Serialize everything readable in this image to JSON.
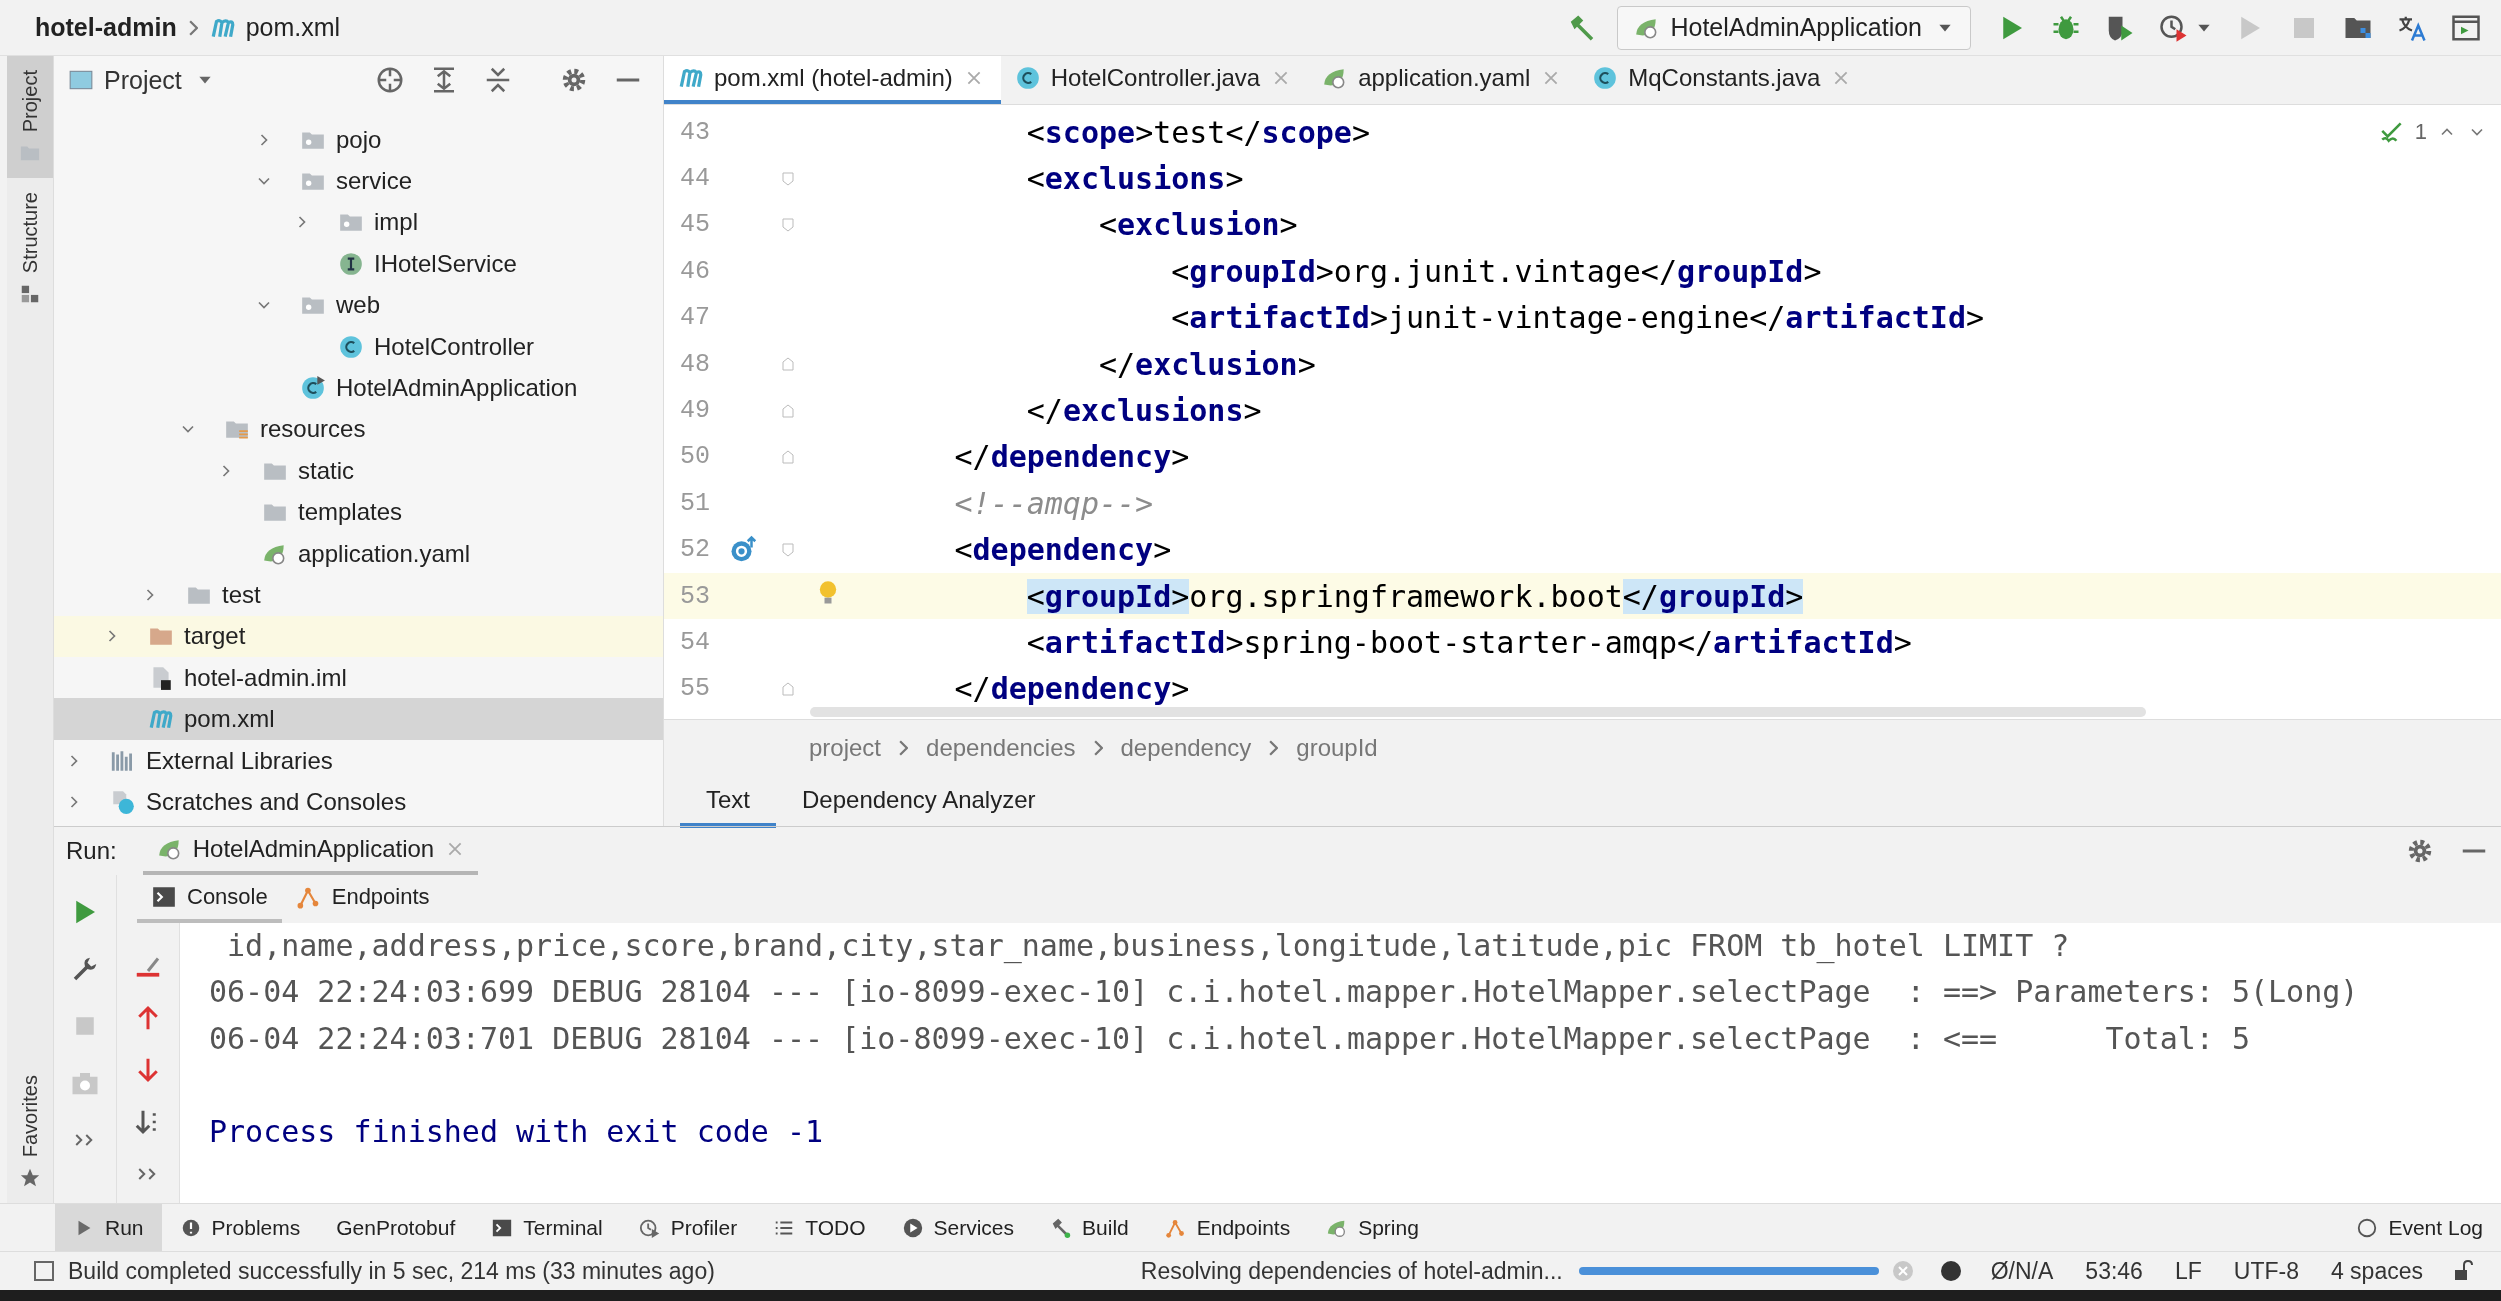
{
  "nav_bar": {
    "breadcrumbs": [
      {
        "label": "hotel-admin"
      },
      {
        "label": "pom.xml",
        "kind": "maven"
      }
    ],
    "run_config": "HotelAdminApplication"
  },
  "side_stripe": {
    "top": [
      {
        "label": "Project",
        "kind": "folder",
        "selected": true
      },
      {
        "label": "Structure",
        "kind": "structure",
        "selected": false
      }
    ],
    "bottom": [
      {
        "label": "Favorites",
        "kind": "star",
        "selected": false
      }
    ]
  },
  "project_panel": {
    "title": "Project",
    "tree": [
      {
        "children": [
          {
            "children": [
              {
                "children": [
                  {
                    "children": [
                      {
                        "children": [
                          {
                            "label": "pojo",
                            "kind": "package",
                            "expanded": false,
                            "selected": false
                          },
                          {
                            "label": "service",
                            "kind": "package",
                            "expanded": true,
                            "selected": false,
                            "children": [
                              {
                                "label": "impl",
                                "kind": "package",
                                "expanded": false,
                                "selected": false
                              },
                              {
                                "label": "IHotelService",
                                "kind": "interface",
                                "selected": false
                              }
                            ]
                          },
                          {
                            "label": "web",
                            "kind": "package",
                            "expanded": true,
                            "selected": false,
                            "children": [
                              {
                                "label": "HotelController",
                                "kind": "class",
                                "selected": false
                              }
                            ]
                          },
                          {
                            "label": "HotelAdminApplication",
                            "kind": "spring-class",
                            "selected": false
                          }
                        ]
                      }
                    ]
                  },
                  {
                    "label": "resources",
                    "kind": "resources",
                    "expanded": true,
                    "selected": false,
                    "children": [
                      {
                        "label": "static",
                        "kind": "folder",
                        "expanded": false,
                        "selected": false
                      },
                      {
                        "label": "templates",
                        "kind": "folder",
                        "selected": false
                      },
                      {
                        "label": "application.yaml",
                        "kind": "spring",
                        "selected": false
                      }
                    ]
                  }
                ]
              },
              {
                "label": "test",
                "kind": "folder",
                "expanded": false,
                "selected": false
              }
            ]
          },
          {
            "label": "target",
            "kind": "excluded",
            "expanded": false,
            "selected": false
          },
          {
            "label": "hotel-admin.iml",
            "kind": "iml",
            "selected": false
          },
          {
            "label": "pom.xml",
            "kind": "maven",
            "selected": true
          }
        ]
      },
      {
        "label": "External Libraries",
        "kind": "libraries",
        "expanded": false,
        "selected": false
      },
      {
        "label": "Scratches and Consoles",
        "kind": "scratches",
        "expanded": false,
        "selected": false
      }
    ]
  },
  "editor": {
    "tabs": [
      {
        "label": "pom.xml (hotel-admin)",
        "kind": "maven",
        "selected": true
      },
      {
        "label": "HotelController.java",
        "kind": "class",
        "selected": false
      },
      {
        "label": "application.yaml",
        "kind": "spring",
        "selected": false
      },
      {
        "label": "MqConstants.java",
        "kind": "class",
        "selected": false
      }
    ],
    "inspection": {
      "count": "1"
    },
    "lines": [
      {
        "number": "43",
        "code": "            <scope>test</scope>",
        "current": false
      },
      {
        "number": "44",
        "code": "            <exclusions>",
        "gutter_marks": [
          {
            "kind": "fold-start"
          }
        ],
        "current": false
      },
      {
        "number": "45",
        "code": "                <exclusion>",
        "gutter_marks": [
          {
            "kind": "fold-start"
          }
        ],
        "current": false
      },
      {
        "number": "46",
        "code": "                    <groupId>org.junit.vintage</groupId>",
        "current": false
      },
      {
        "number": "47",
        "code": "                    <artifactId>junit-vintage-engine</artifactId>",
        "current": false
      },
      {
        "number": "48",
        "code": "                </exclusion>",
        "gutter_marks": [
          {
            "kind": "fold-end"
          }
        ],
        "current": false
      },
      {
        "number": "49",
        "code": "            </exclusions>",
        "gutter_marks": [
          {
            "kind": "fold-end"
          }
        ],
        "current": false
      },
      {
        "number": "50",
        "code": "        </dependency>",
        "gutter_marks": [
          {
            "kind": "fold-end"
          }
        ],
        "current": false
      },
      {
        "number": "51",
        "code": "        <!--amqp-->",
        "current": false
      },
      {
        "number": "52",
        "code": "        <dependency>",
        "gutter_marks": [
          {
            "kind": "overrides"
          },
          {
            "kind": "fold-start"
          }
        ],
        "current": false
      },
      {
        "number": "53",
        "code": "            <groupId>org.springframework.boot</groupId>",
        "gutter_marks": [
          {
            "kind": "bulb"
          }
        ],
        "current": true,
        "matched_tags": true
      },
      {
        "number": "54",
        "code": "            <artifactId>spring-boot-starter-amqp</artifactId>",
        "current": false
      },
      {
        "number": "55",
        "code": "        </dependency>",
        "gutter_marks": [
          {
            "kind": "fold-end"
          }
        ],
        "current": false
      }
    ],
    "breadcrumbs": [
      "project",
      "dependencies",
      "dependency",
      "groupId"
    ],
    "view_tabs": [
      {
        "label": "Text",
        "selected": true
      },
      {
        "label": "Dependency Analyzer",
        "selected": false
      }
    ]
  },
  "run_panel": {
    "label": "Run:",
    "tabs": [
      {
        "label": "HotelAdminApplication",
        "selected": true
      }
    ],
    "subtabs": [
      {
        "label": "Console",
        "kind": "console",
        "selected": true
      },
      {
        "label": "Endpoints",
        "kind": "endpoints",
        "selected": false
      }
    ],
    "console": [
      {
        "text": " id,name,address,price,score,brand,city,star_name,business,longitude,latitude,pic FROM tb_hotel LIMIT ?",
        "kind": "log"
      },
      {
        "text": "06-04 22:24:03:699 DEBUG 28104 --- [io-8099-exec-10] c.i.hotel.mapper.HotelMapper.selectPage  : ==> Parameters: 5(Long)",
        "kind": "log"
      },
      {
        "text": "06-04 22:24:03:701 DEBUG 28104 --- [io-8099-exec-10] c.i.hotel.mapper.HotelMapper.selectPage  : <==      Total: 5",
        "kind": "log"
      },
      {
        "text": "Process finished with exit code -1",
        "kind": "exit"
      }
    ]
  },
  "tool_bar": [
    {
      "label": "Run",
      "kind": "run",
      "selected": true
    },
    {
      "label": "Problems",
      "kind": "problems",
      "selected": false
    },
    {
      "label": "GenProtobuf",
      "kind": "plain",
      "selected": false
    },
    {
      "label": "Terminal",
      "kind": "terminal",
      "selected": false
    },
    {
      "label": "Profiler",
      "kind": "profiler",
      "selected": false
    },
    {
      "label": "TODO",
      "kind": "todo",
      "selected": false
    },
    {
      "label": "Services",
      "kind": "services",
      "selected": false
    },
    {
      "label": "Build",
      "kind": "build",
      "selected": false
    },
    {
      "label": "Endpoints",
      "kind": "endpoints",
      "selected": false
    },
    {
      "label": "Spring",
      "kind": "spring",
      "selected": false
    }
  ],
  "event_log": "Event Log",
  "status_bar": {
    "message": "Build completed successfully in 5 sec, 214 ms (33 minutes ago)",
    "task": "Resolving dependencies of hotel-admin...",
    "progress": {
      "level": 1
    },
    "items": [
      "Ø/N/A",
      "53:46",
      "LF",
      "UTF-8",
      "4 spaces"
    ]
  }
}
